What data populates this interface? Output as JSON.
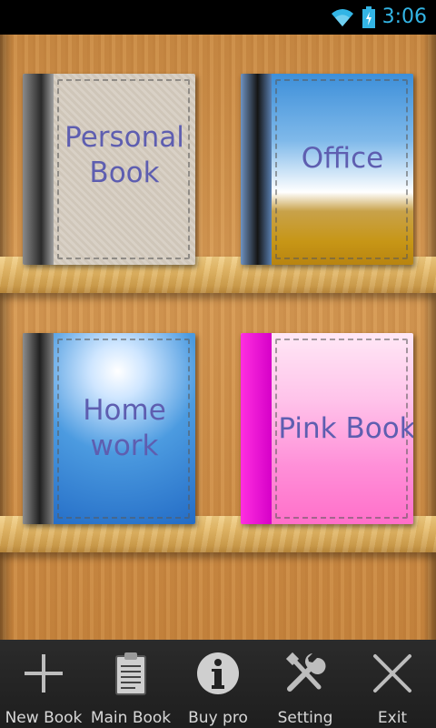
{
  "status_bar": {
    "time": "3:06",
    "icons": [
      "wifi-icon",
      "battery-charging-icon"
    ],
    "accent_color": "#33b5e5"
  },
  "books": [
    {
      "title_line1": "Personal",
      "title_line2": "Book"
    },
    {
      "title_line1": "Office",
      "title_line2": ""
    },
    {
      "title_line1": "Home",
      "title_line2": "work"
    },
    {
      "title_line1": "Pink Book",
      "title_line2": ""
    }
  ],
  "toolbar": {
    "items": [
      {
        "label": "New Book",
        "icon": "plus-icon"
      },
      {
        "label": "Main Book",
        "icon": "clipboard-icon"
      },
      {
        "label": "Buy pro",
        "icon": "info-icon"
      },
      {
        "label": "Setting",
        "icon": "wrench-screwdriver-icon"
      },
      {
        "label": "Exit",
        "icon": "close-icon"
      }
    ]
  }
}
